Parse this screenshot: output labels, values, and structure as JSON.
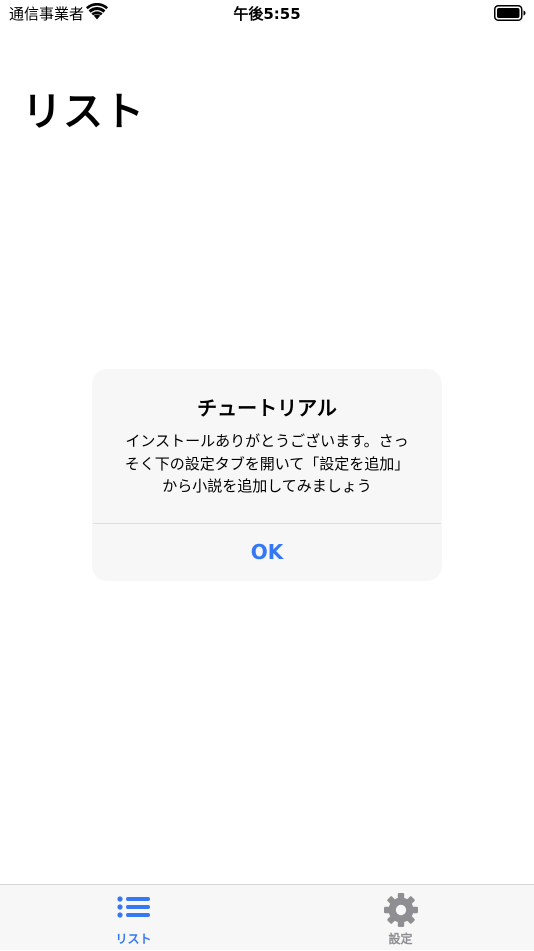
{
  "status_bar": {
    "carrier": "通信事業者",
    "time": "午後5:55"
  },
  "page": {
    "title": "リスト"
  },
  "alert": {
    "title": "チュートリアル",
    "message_lines": [
      "インストールありがとうございます。さっ",
      "そく下の設定タブを開いて「設定を追加」",
      "から小説を追加してみましょう"
    ],
    "ok_label": "OK"
  },
  "tab_bar": {
    "items": [
      {
        "label": "リスト",
        "icon": "list-icon",
        "selected": true
      },
      {
        "label": "設定",
        "icon": "gear-icon",
        "selected": false
      }
    ]
  },
  "colors": {
    "accent": "#3478f6",
    "inactive": "#8e8e93",
    "alert_background": "#f7f7f7",
    "tab_bar_background": "#f7f7f7"
  }
}
